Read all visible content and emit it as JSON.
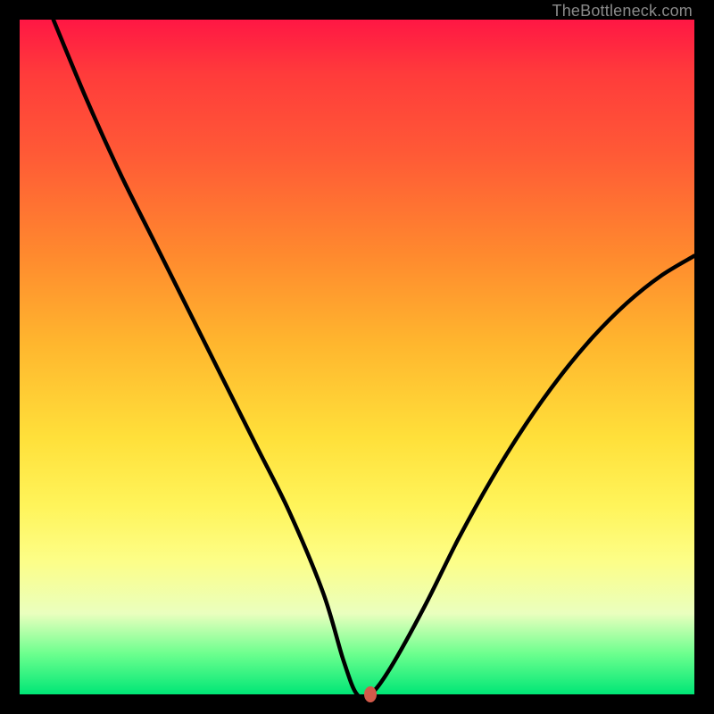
{
  "watermark": "TheBottleneck.com",
  "colors": {
    "frame": "#000000",
    "curve": "#000000",
    "marker": "#d25a4a"
  },
  "chart_data": {
    "type": "line",
    "title": "",
    "xlabel": "",
    "ylabel": "",
    "xlim": [
      0,
      100
    ],
    "ylim": [
      0,
      100
    ],
    "grid": false,
    "series": [
      {
        "name": "bottleneck-curve",
        "x": [
          5,
          10,
          15,
          20,
          25,
          30,
          35,
          40,
          45,
          48,
          50,
          52,
          55,
          60,
          65,
          70,
          75,
          80,
          85,
          90,
          95,
          100
        ],
        "y": [
          100,
          88,
          77,
          67,
          57,
          47,
          37,
          27,
          15,
          5,
          0,
          0,
          4,
          13,
          23,
          32,
          40,
          47,
          53,
          58,
          62,
          65
        ]
      }
    ],
    "annotations": [
      {
        "name": "marker",
        "x": 52,
        "y": 0
      }
    ],
    "background_gradient": [
      {
        "pos": 0.0,
        "color": "#ff1744"
      },
      {
        "pos": 0.35,
        "color": "#ff8a2e"
      },
      {
        "pos": 0.62,
        "color": "#ffe03a"
      },
      {
        "pos": 0.8,
        "color": "#fdfe86"
      },
      {
        "pos": 1.0,
        "color": "#00e676"
      }
    ]
  }
}
